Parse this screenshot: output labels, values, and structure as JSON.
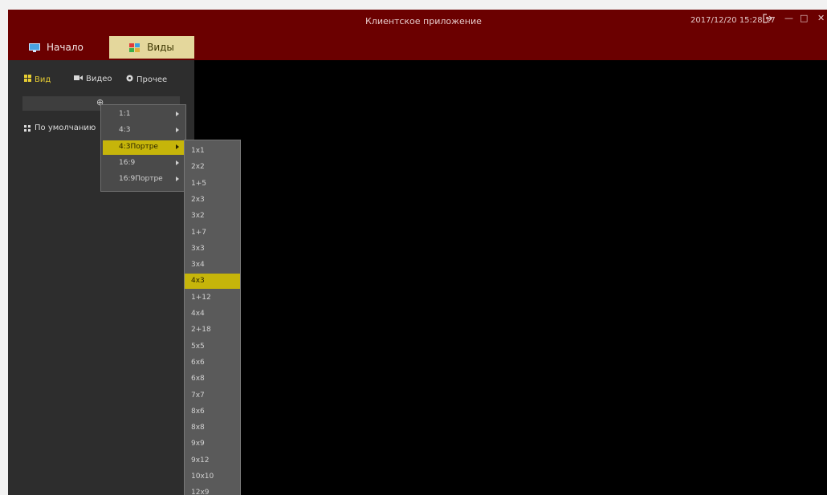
{
  "window": {
    "title": "Клиентское приложение",
    "datetime": "2017/12/20 15:28:17",
    "logout_icon": "logout-icon",
    "minimize_glyph": "—",
    "maximize_glyph": "□",
    "close_glyph": "✕"
  },
  "main_tabs": [
    {
      "label": "Начало",
      "icon": "monitor-icon"
    },
    {
      "label": "Виды",
      "icon": "views-grid-icon",
      "active": true
    }
  ],
  "sub_tabs": [
    {
      "label": "Вид",
      "icon": "grid-icon",
      "active": true
    },
    {
      "label": "Видео",
      "icon": "camera-icon"
    },
    {
      "label": "Прочее",
      "icon": "gear-icon"
    }
  ],
  "sidebar": {
    "add_icon": "add-icon",
    "add_glyph": "⊕",
    "default_item": "По умолчанию"
  },
  "aspect_menu": {
    "items": [
      "1:1",
      "4:3",
      "4:3Портре",
      "16:9",
      "16:9Портре"
    ],
    "selected": "4:3Портре"
  },
  "layout_menu": {
    "items": [
      "1x1",
      "2x2",
      "1+5",
      "2x3",
      "3x2",
      "1+7",
      "3x3",
      "3x4",
      "4x3",
      "1+12",
      "4x4",
      "2+18",
      "5x5",
      "6x6",
      "6x8",
      "7x7",
      "8x6",
      "8x8",
      "9x9",
      "9x12",
      "10x10",
      "12x9"
    ],
    "selected": "4x3"
  },
  "colors": {
    "titlebar": "#6b0000",
    "active_tab": "#e4d79c",
    "highlight": "#c6b50a",
    "sidebar": "#2d2d2d",
    "background": "#000000"
  }
}
